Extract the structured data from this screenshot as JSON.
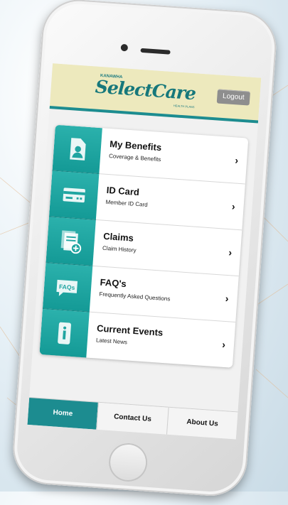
{
  "header": {
    "brand_small": "KANAWHA",
    "logo_text": "SelectCare",
    "logo_tag": "HEALTH PLANS",
    "logout_label": "Logout"
  },
  "menu": [
    {
      "title": "My Benefits",
      "subtitle": "Coverage & Benefits",
      "icon": "document-person-icon"
    },
    {
      "title": "ID Card",
      "subtitle": "Member ID Card",
      "icon": "id-card-icon"
    },
    {
      "title": "Claims",
      "subtitle": "Claim History",
      "icon": "claims-add-icon"
    },
    {
      "title": "FAQ's",
      "subtitle": "Frequently Asked Questions",
      "icon": "faq-bubble-icon"
    },
    {
      "title": "Current Events",
      "subtitle": "Latest News",
      "icon": "info-icon"
    }
  ],
  "chevron": "›",
  "tabs": [
    "Home",
    "Contact Us",
    "About Us"
  ],
  "colors": {
    "teal": "#1c8c90",
    "header_bg": "#ede9bd",
    "logout_bg": "#8e8e8e"
  }
}
